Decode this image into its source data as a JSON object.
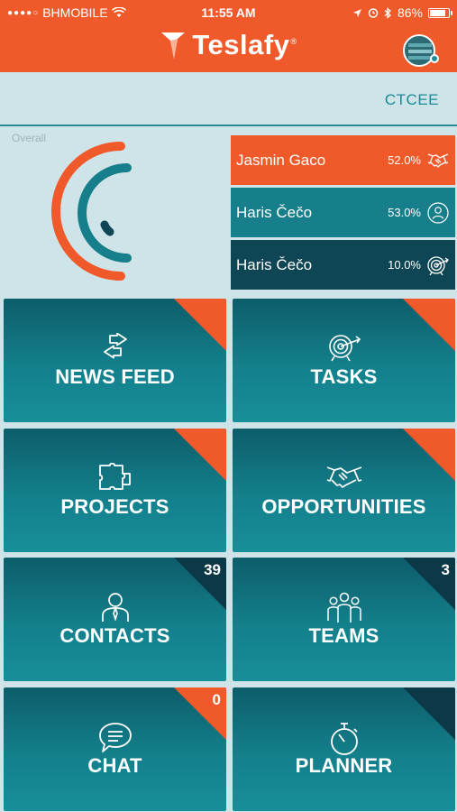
{
  "status_bar": {
    "carrier": "BHMOBILE",
    "time": "11:55 AM",
    "battery": "86%",
    "signal_icon": "signal-dots-icon",
    "wifi_icon": "wifi-icon",
    "battery_level": 0.86
  },
  "header": {
    "brand_name": "Teslafy",
    "brand_mark": "®",
    "logo_icon": "teslafy-logo-icon",
    "avatar_icon": "company-avatar-icon"
  },
  "company": {
    "name": "CTCEE"
  },
  "overall": {
    "label": "Overall",
    "stats": [
      {
        "name": "Jasmin Gaco",
        "percent": "52.0%",
        "icon": "handshake-icon",
        "color": "#f0592a"
      },
      {
        "name": "Haris Čečo",
        "percent": "53.0%",
        "icon": "person-icon",
        "color": "#167f8b"
      },
      {
        "name": "Haris Čečo",
        "percent": "10.0%",
        "icon": "target-icon",
        "color": "#0f4655"
      }
    ]
  },
  "tiles": [
    {
      "label": "NEWS FEED",
      "icon": "arrows-icon",
      "badge": "",
      "corner": "orange"
    },
    {
      "label": "TASKS",
      "icon": "target-icon",
      "badge": "",
      "corner": "orange"
    },
    {
      "label": "PROJECTS",
      "icon": "puzzle-icon",
      "badge": "",
      "corner": "orange"
    },
    {
      "label": "OPPORTUNITIES",
      "icon": "handshake-icon",
      "badge": "",
      "corner": "orange"
    },
    {
      "label": "CONTACTS",
      "icon": "person-icon",
      "badge": "39",
      "corner": "dark"
    },
    {
      "label": "TEAMS",
      "icon": "team-icon",
      "badge": "3",
      "corner": "dark"
    },
    {
      "label": "CHAT",
      "icon": "chat-icon",
      "badge": "0",
      "corner": "orange"
    },
    {
      "label": "PLANNER",
      "icon": "stopwatch-icon",
      "badge": "",
      "corner": "dark"
    }
  ],
  "colors": {
    "brand_orange": "#f0592a",
    "teal": "#167f8b",
    "dark_teal": "#0f4655",
    "background": "#cfe4e8"
  }
}
